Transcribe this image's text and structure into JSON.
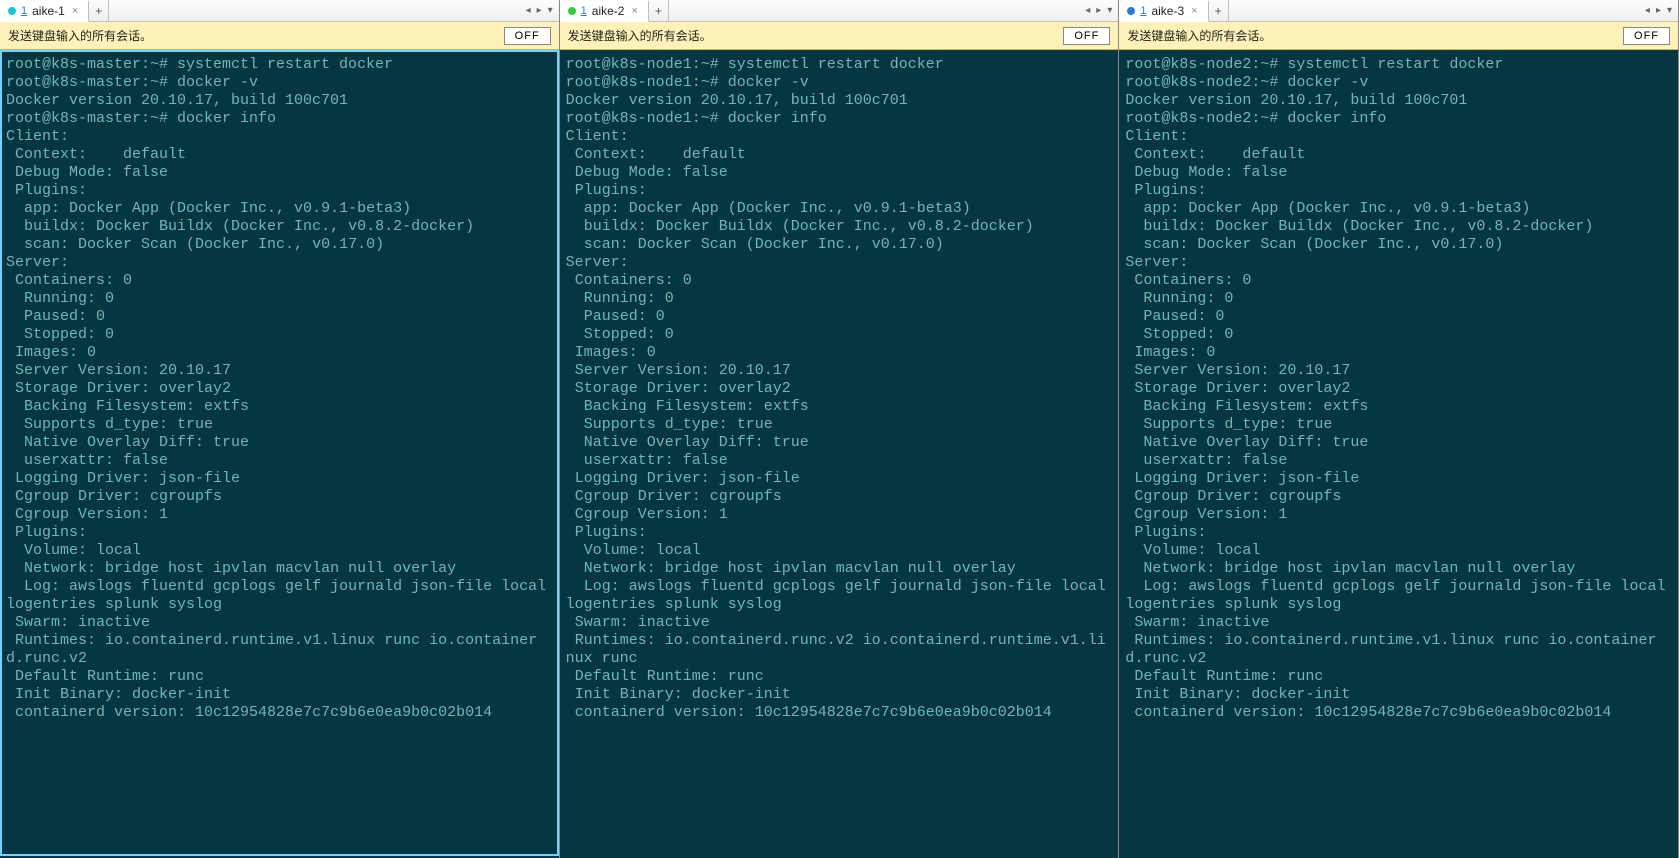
{
  "broadcast": {
    "message": "发送键盘输入的所有会话。",
    "toggle_label": "OFF"
  },
  "tabbar": {
    "nav_left": "◂",
    "nav_right": "▸",
    "nav_menu": "▾",
    "add_label": "+",
    "close_label": "×"
  },
  "panes": [
    {
      "tab": {
        "index": "1",
        "name": "aike-1",
        "dot": "cyan",
        "active": true,
        "selected": true
      },
      "prompt_host": "root@k8s-master:~#",
      "lines": [
        "root@k8s-master:~# systemctl restart docker",
        "root@k8s-master:~# docker -v",
        "Docker version 20.10.17, build 100c701",
        "root@k8s-master:~# docker info",
        "Client:",
        " Context:    default",
        " Debug Mode: false",
        " Plugins:",
        "  app: Docker App (Docker Inc., v0.9.1-beta3)",
        "  buildx: Docker Buildx (Docker Inc., v0.8.2-docker)",
        "  scan: Docker Scan (Docker Inc., v0.17.0)",
        "",
        "Server:",
        " Containers: 0",
        "  Running: 0",
        "  Paused: 0",
        "  Stopped: 0",
        " Images: 0",
        " Server Version: 20.10.17",
        " Storage Driver: overlay2",
        "  Backing Filesystem: extfs",
        "  Supports d_type: true",
        "  Native Overlay Diff: true",
        "  userxattr: false",
        " Logging Driver: json-file",
        " Cgroup Driver: cgroupfs",
        " Cgroup Version: 1",
        " Plugins:",
        "  Volume: local",
        "  Network: bridge host ipvlan macvlan null overlay",
        "  Log: awslogs fluentd gcplogs gelf journald json-file local logentries splunk syslog",
        " Swarm: inactive",
        " Runtimes: io.containerd.runtime.v1.linux runc io.containerd.runc.v2",
        " Default Runtime: runc",
        " Init Binary: docker-init",
        " containerd version: 10c12954828e7c7c9b6e0ea9b0c02b014"
      ]
    },
    {
      "tab": {
        "index": "1",
        "name": "aike-2",
        "dot": "green",
        "active": true,
        "selected": false
      },
      "prompt_host": "root@k8s-node1:~#",
      "lines": [
        "root@k8s-node1:~# systemctl restart docker",
        "root@k8s-node1:~# docker -v",
        "Docker version 20.10.17, build 100c701",
        "root@k8s-node1:~# docker info",
        "Client:",
        " Context:    default",
        " Debug Mode: false",
        " Plugins:",
        "  app: Docker App (Docker Inc., v0.9.1-beta3)",
        "  buildx: Docker Buildx (Docker Inc., v0.8.2-docker)",
        "  scan: Docker Scan (Docker Inc., v0.17.0)",
        "",
        "Server:",
        " Containers: 0",
        "  Running: 0",
        "  Paused: 0",
        "  Stopped: 0",
        " Images: 0",
        " Server Version: 20.10.17",
        " Storage Driver: overlay2",
        "  Backing Filesystem: extfs",
        "  Supports d_type: true",
        "  Native Overlay Diff: true",
        "  userxattr: false",
        " Logging Driver: json-file",
        " Cgroup Driver: cgroupfs",
        " Cgroup Version: 1",
        " Plugins:",
        "  Volume: local",
        "  Network: bridge host ipvlan macvlan null overlay",
        "  Log: awslogs fluentd gcplogs gelf journald json-file local logentries splunk syslog",
        " Swarm: inactive",
        " Runtimes: io.containerd.runc.v2 io.containerd.runtime.v1.linux runc",
        " Default Runtime: runc",
        " Init Binary: docker-init",
        " containerd version: 10c12954828e7c7c9b6e0ea9b0c02b014"
      ]
    },
    {
      "tab": {
        "index": "1",
        "name": "aike-3",
        "dot": "blue",
        "active": true,
        "selected": false
      },
      "prompt_host": "root@k8s-node2:~#",
      "lines": [
        "root@k8s-node2:~# systemctl restart docker",
        "root@k8s-node2:~# docker -v",
        "Docker version 20.10.17, build 100c701",
        "root@k8s-node2:~# docker info",
        "Client:",
        " Context:    default",
        " Debug Mode: false",
        " Plugins:",
        "  app: Docker App (Docker Inc., v0.9.1-beta3)",
        "  buildx: Docker Buildx (Docker Inc., v0.8.2-docker)",
        "  scan: Docker Scan (Docker Inc., v0.17.0)",
        "",
        "Server:",
        " Containers: 0",
        "  Running: 0",
        "  Paused: 0",
        "  Stopped: 0",
        " Images: 0",
        " Server Version: 20.10.17",
        " Storage Driver: overlay2",
        "  Backing Filesystem: extfs",
        "  Supports d_type: true",
        "  Native Overlay Diff: true",
        "  userxattr: false",
        " Logging Driver: json-file",
        " Cgroup Driver: cgroupfs",
        " Cgroup Version: 1",
        " Plugins:",
        "  Volume: local",
        "  Network: bridge host ipvlan macvlan null overlay",
        "  Log: awslogs fluentd gcplogs gelf journald json-file local logentries splunk syslog",
        " Swarm: inactive",
        " Runtimes: io.containerd.runtime.v1.linux runc io.containerd.runc.v2",
        " Default Runtime: runc",
        " Init Binary: docker-init",
        " containerd version: 10c12954828e7c7c9b6e0ea9b0c02b014"
      ]
    }
  ]
}
